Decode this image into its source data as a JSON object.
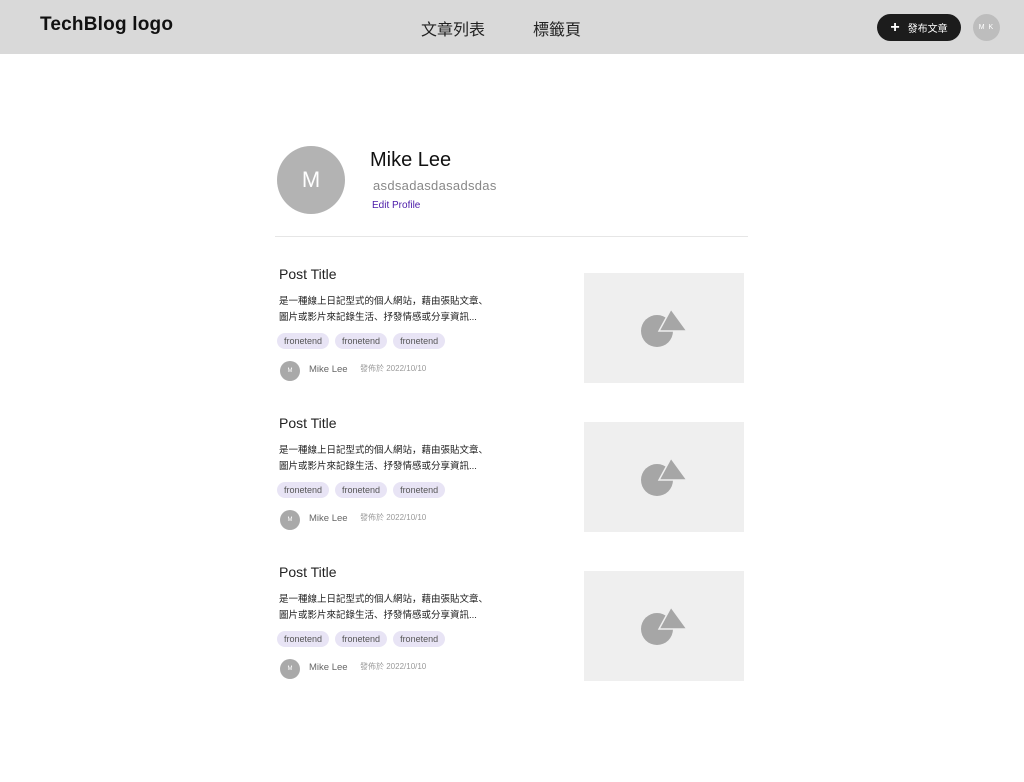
{
  "header": {
    "logo": "TechBlog logo",
    "nav": [
      "文章列表",
      "標籤頁"
    ],
    "publish_label": "發布文章",
    "user_initials": "M K"
  },
  "profile": {
    "initial": "M",
    "name": "Mike Lee",
    "bio": "asdsadasdasadsdas",
    "edit_label": "Edit Profile"
  },
  "posts": [
    {
      "title": "Post Title",
      "excerpt_line1": "是一種線上日記型式的個人網站，藉由張貼文章、",
      "excerpt_line2": "圖片或影片來記錄生活、抒發情感或分享資訊...",
      "tags": [
        "fronetend",
        "fronetend",
        "fronetend"
      ],
      "author_initial": "M",
      "author": "Mike Lee",
      "date": "發佈於 2022/10/10",
      "image_icon": "image-placeholder-icon"
    },
    {
      "title": "Post Title",
      "excerpt_line1": "是一種線上日記型式的個人網站，藉由張貼文章、",
      "excerpt_line2": "圖片或影片來記錄生活、抒發情感或分享資訊...",
      "tags": [
        "fronetend",
        "fronetend",
        "fronetend"
      ],
      "author_initial": "M",
      "author": "Mike Lee",
      "date": "發佈於 2022/10/10",
      "image_icon": "image-placeholder-icon"
    },
    {
      "title": "Post Title",
      "excerpt_line1": "是一種線上日記型式的個人網站，藉由張貼文章、",
      "excerpt_line2": "圖片或影片來記錄生活、抒發情感或分享資訊...",
      "tags": [
        "fronetend",
        "fronetend",
        "fronetend"
      ],
      "author_initial": "M",
      "author": "Mike Lee",
      "date": "發佈於 2022/10/10",
      "image_icon": "image-placeholder-icon"
    }
  ],
  "colors": {
    "header_bg": "#d9d9d9",
    "accent": "#4a1aa8",
    "tag_bg": "#e8e4f5",
    "button_bg": "#1c1c1c"
  }
}
